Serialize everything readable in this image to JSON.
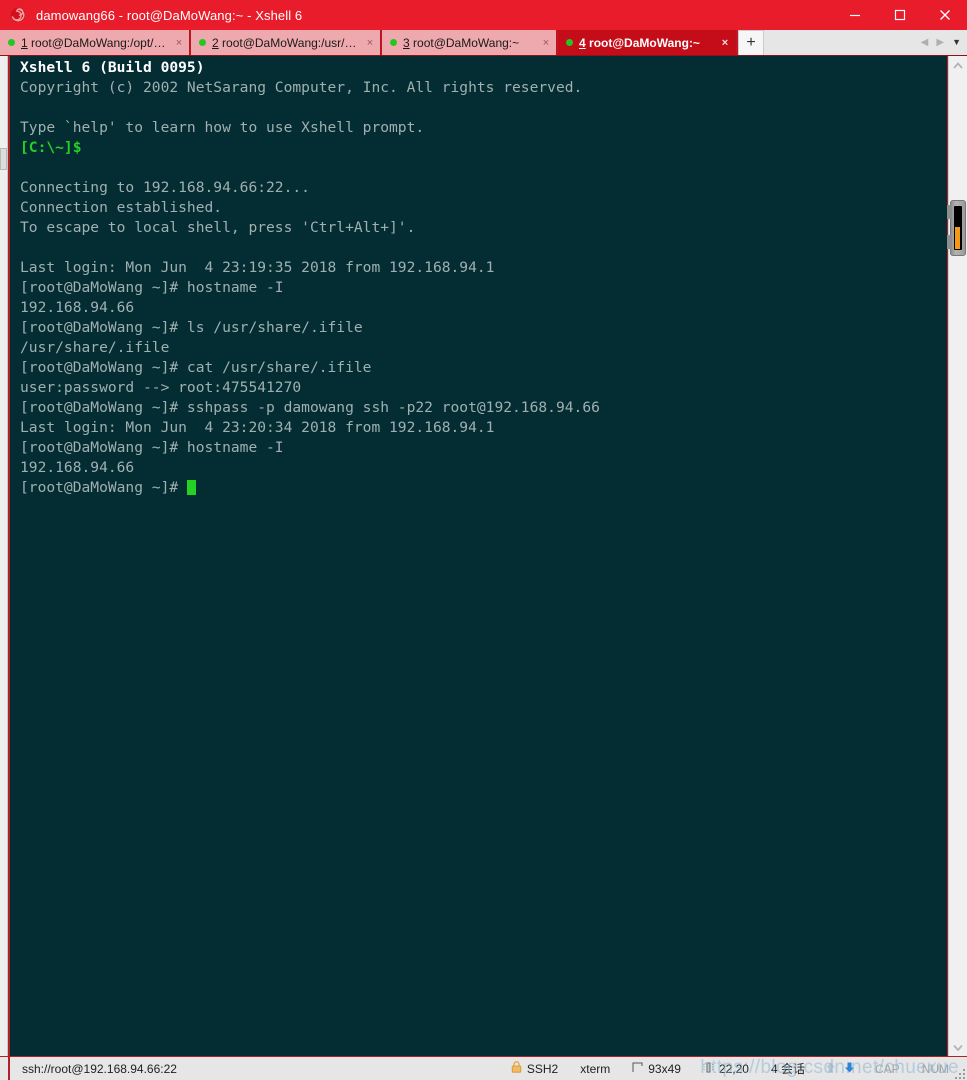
{
  "window": {
    "title": "damowang66 - root@DaMoWang:~ - Xshell 6",
    "icon": "xshell-spiral-icon",
    "minimize_label": "─",
    "maximize_label": "□",
    "close_label": "✕",
    "colors": {
      "titlebar": "#e81c2a",
      "tabbar": "#c21621",
      "tab_active": "#c40d18",
      "tab_inactive": "#eda9ad",
      "terminal_bg": "#042c33",
      "terminal_fg": "#a8b8b8",
      "accent_green": "#23d223",
      "scroll_orange": "#f59a16",
      "statusbar": "#e6e6e6"
    }
  },
  "tabs": {
    "items": [
      {
        "num": "1",
        "label": "root@DaMoWang:/opt/ope...",
        "active": false,
        "close_label": "×",
        "status_dot": "green"
      },
      {
        "num": "2",
        "label": "root@DaMoWang:/usr/share",
        "active": false,
        "close_label": "×",
        "status_dot": "green"
      },
      {
        "num": "3",
        "label": "root@DaMoWang:~",
        "active": false,
        "close_label": "×",
        "status_dot": "green"
      },
      {
        "num": "4",
        "label": "root@DaMoWang:~",
        "active": true,
        "close_label": "×",
        "status_dot": "green"
      }
    ],
    "new_tab_label": "+",
    "nav_prev": "◀",
    "nav_next": "▶",
    "nav_menu": "▼"
  },
  "terminal": {
    "lines": [
      {
        "text": "Xshell 6 (Build 0095)",
        "style": "white"
      },
      {
        "text": "Copyright (c) 2002 NetSarang Computer, Inc. All rights reserved.",
        "style": "grey"
      },
      {
        "text": "",
        "style": "grey"
      },
      {
        "text": "Type `help' to learn how to use Xshell prompt.",
        "style": "grey"
      },
      {
        "text": "[C:\\~]$",
        "style": "green"
      },
      {
        "text": "",
        "style": "grey"
      },
      {
        "text": "Connecting to 192.168.94.66:22...",
        "style": "grey"
      },
      {
        "text": "Connection established.",
        "style": "grey"
      },
      {
        "text": "To escape to local shell, press 'Ctrl+Alt+]'.",
        "style": "grey"
      },
      {
        "text": "",
        "style": "grey"
      },
      {
        "text": "Last login: Mon Jun  4 23:19:35 2018 from 192.168.94.1",
        "style": "grey"
      },
      {
        "text": "[root@DaMoWang ~]# hostname -I",
        "style": "grey"
      },
      {
        "text": "192.168.94.66",
        "style": "grey"
      },
      {
        "text": "[root@DaMoWang ~]# ls /usr/share/.ifile",
        "style": "grey"
      },
      {
        "text": "/usr/share/.ifile",
        "style": "grey"
      },
      {
        "text": "[root@DaMoWang ~]# cat /usr/share/.ifile",
        "style": "grey"
      },
      {
        "text": "user:password --> root:475541270",
        "style": "grey"
      },
      {
        "text": "[root@DaMoWang ~]# sshpass -p damowang ssh -p22 root@192.168.94.66",
        "style": "grey"
      },
      {
        "text": "Last login: Mon Jun  4 23:20:34 2018 from 192.168.94.1",
        "style": "grey"
      },
      {
        "text": "[root@DaMoWang ~]# hostname -I",
        "style": "grey"
      },
      {
        "text": "192.168.94.66",
        "style": "grey"
      },
      {
        "text": "[root@DaMoWang ~]# ",
        "style": "grey",
        "cursor": true
      }
    ]
  },
  "scrollbar": {
    "up_arrow": "⌃",
    "down_arrow": "⌄"
  },
  "statusbar": {
    "connection": "ssh://root@192.168.94.66:22",
    "protocol": "SSH2",
    "terminal_type": "xterm",
    "size_icon": "resize-icon",
    "size": "93x49",
    "cursor_icon": "cursor-position-icon",
    "cursor_pos": "22,20",
    "sessions": "4 会话",
    "upload_icon": "upload-arrow-icon",
    "download_icon": "download-arrow-icon",
    "caps": "CAP",
    "num": "NUM"
  },
  "watermark": {
    "text": "https://blog.csdn.net/chuexue"
  }
}
